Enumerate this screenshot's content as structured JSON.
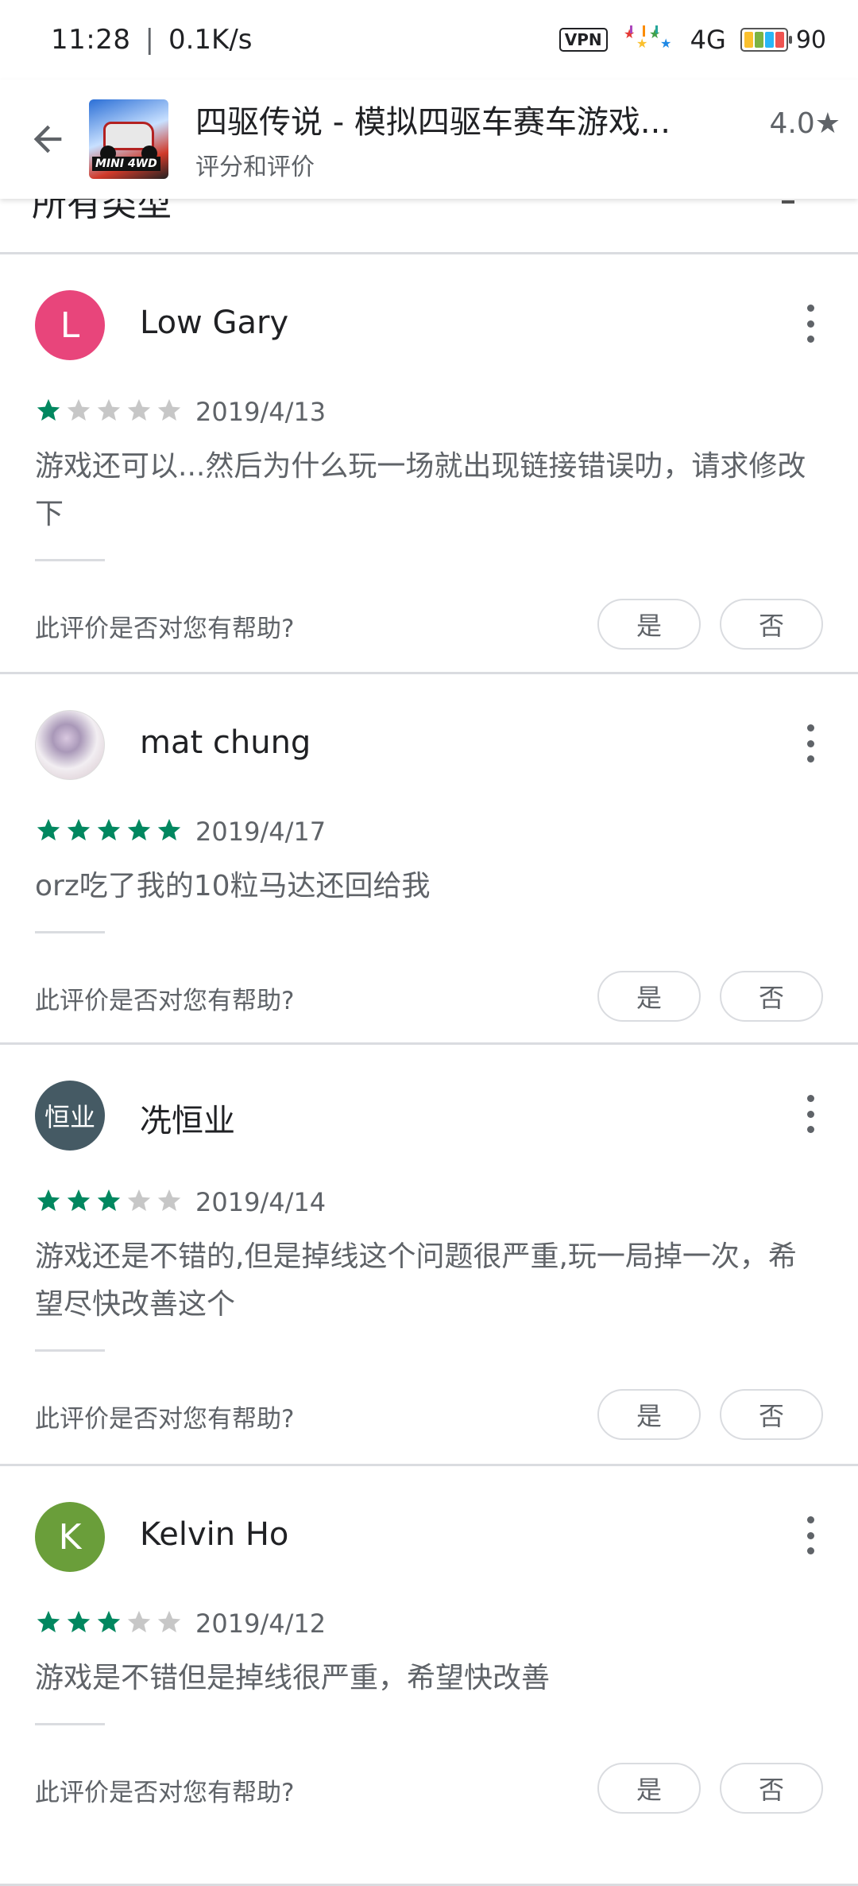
{
  "status_bar": {
    "time": "11:28",
    "separator": "|",
    "network_speed": "0.1K/s",
    "vpn": "VPN",
    "network": "4G",
    "battery": "90"
  },
  "app_bar": {
    "title": "四驱传说 - 模拟四驱车赛车游戏...",
    "subtitle": "评分和评价",
    "rating": "4.0★",
    "icon_badge": "MINI 4WD"
  },
  "filter": {
    "label": "所有类型"
  },
  "colors": {
    "star_filled": "#01875f",
    "star_empty": "#c7c7c7"
  },
  "reviews": [
    {
      "avatar_letter": "L",
      "avatar_color": "#e8457b",
      "name": "Low Gary",
      "stars": 1,
      "date": "2019/4/13",
      "text": "游戏还可以...然后为什么玩一场就出现链接错误叻，请求修改下",
      "helpful_question": "此评价是否对您有帮助?",
      "yes": "是",
      "no": "否"
    },
    {
      "avatar_letter": "",
      "avatar_color": "",
      "name": "mat chung",
      "stars": 5,
      "date": "2019/4/17",
      "text": "orz吃了我的10粒马达还回给我",
      "helpful_question": "此评价是否对您有帮助?",
      "yes": "是",
      "no": "否"
    },
    {
      "avatar_letter": "恒业",
      "avatar_color": "#455a64",
      "name": "冼恒业",
      "stars": 3,
      "date": "2019/4/14",
      "text": "游戏还是不错的,但是掉线这个问题很严重,玩一局掉一次，希望尽快改善这个",
      "helpful_question": "此评价是否对您有帮助?",
      "yes": "是",
      "no": "否"
    },
    {
      "avatar_letter": "K",
      "avatar_color": "#6a9e3a",
      "name": "Kelvin Ho",
      "stars": 3,
      "date": "2019/4/12",
      "text": "游戏是不错但是掉线很严重，希望快改善",
      "helpful_question": "此评价是否对您有帮助?",
      "yes": "是",
      "no": "否"
    }
  ]
}
